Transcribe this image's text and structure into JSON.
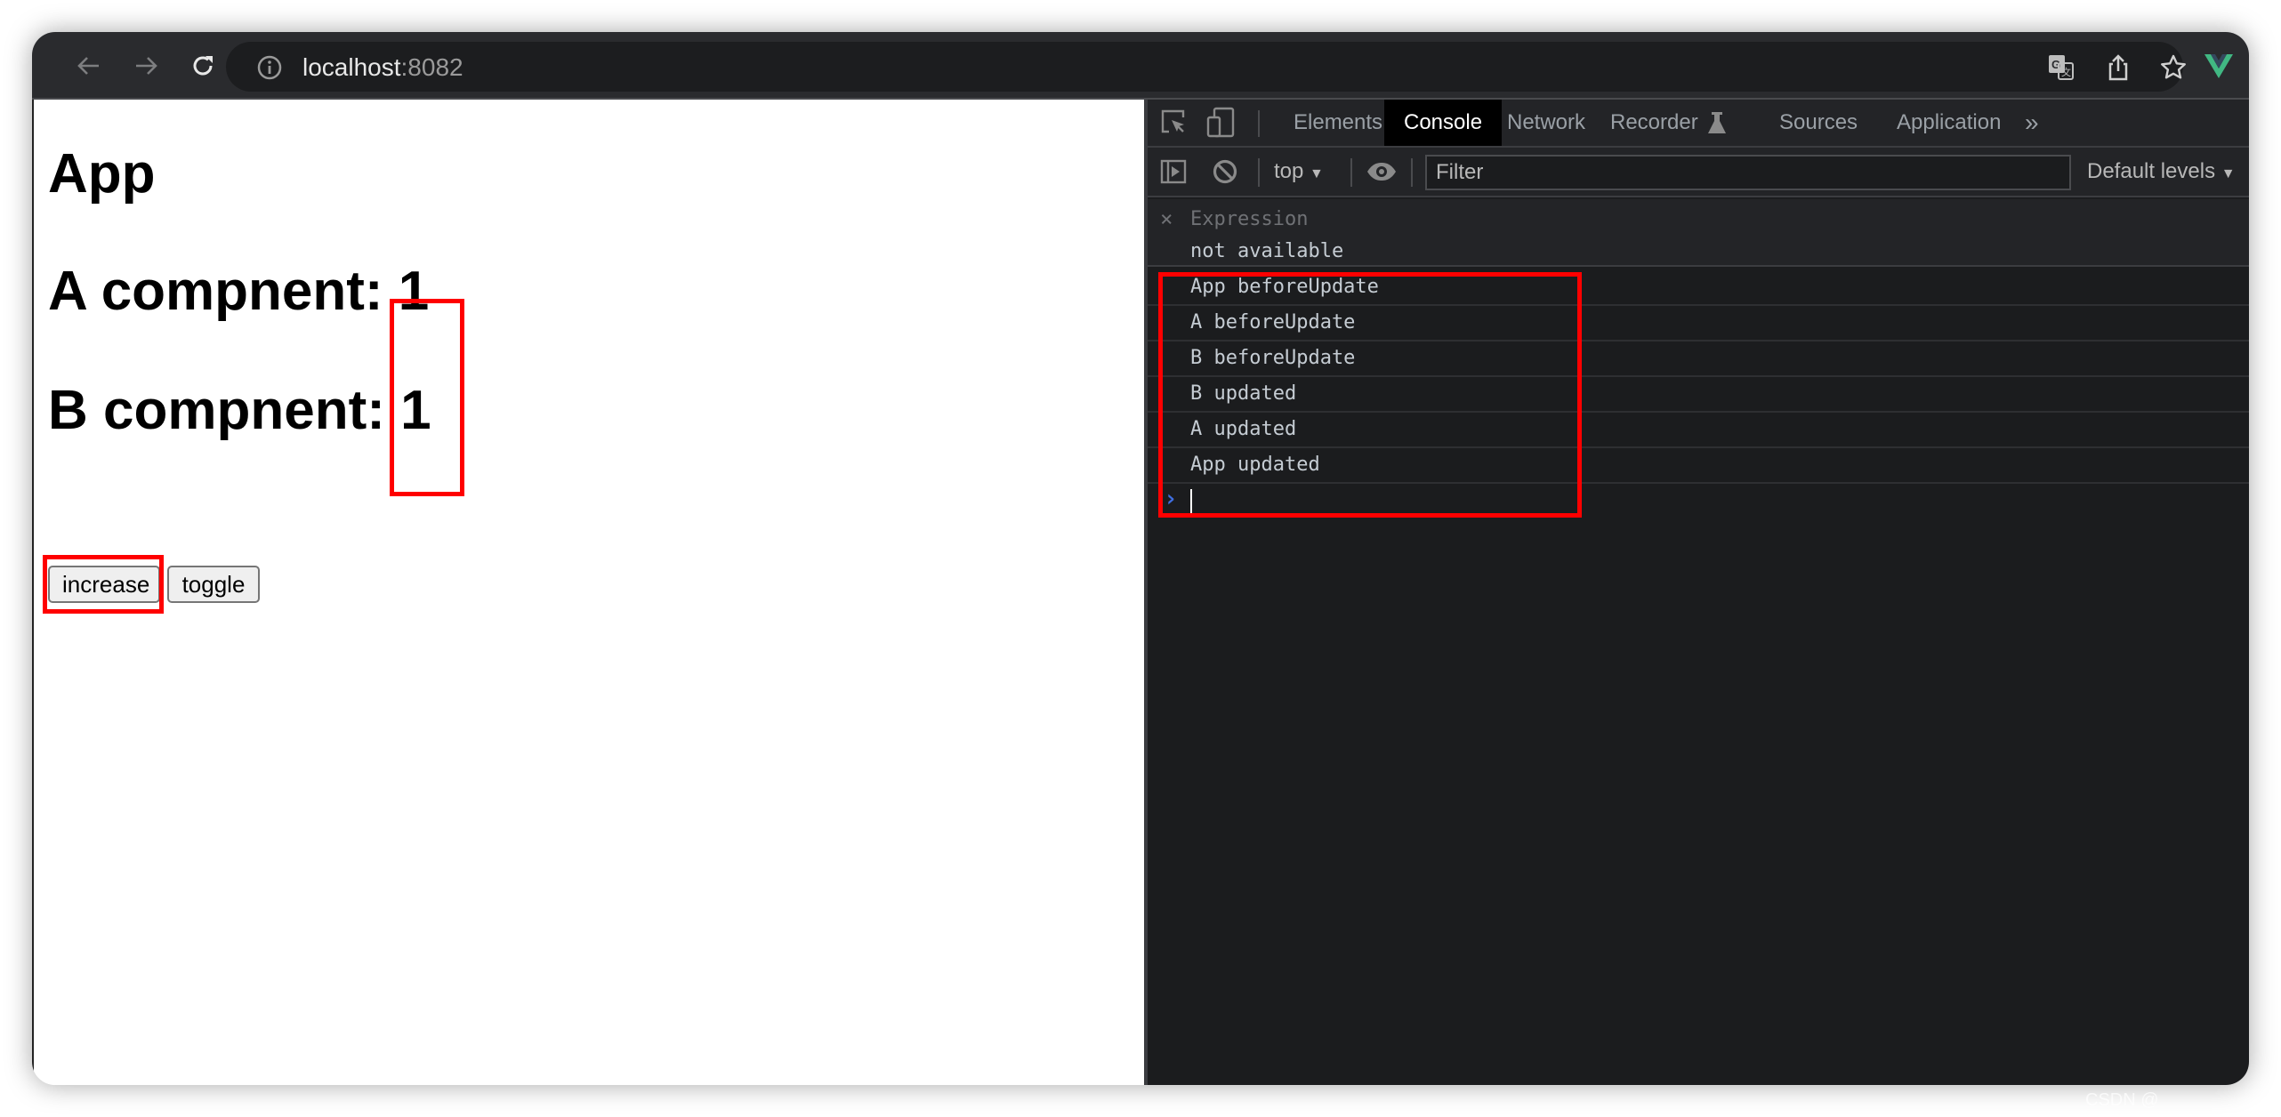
{
  "browser": {
    "url_host": "localhost",
    "url_port": ":8082",
    "icons": [
      "back-icon",
      "forward-icon",
      "reload-icon",
      "info-icon",
      "translate-icon",
      "share-icon",
      "bookmark-star-icon",
      "vue-devtools-icon"
    ],
    "accent_vue": "#41b883"
  },
  "page": {
    "title": "App",
    "a_label": "A compnent: ",
    "a_value": "1",
    "b_label": "B compnent: ",
    "b_value": "1",
    "buttons": {
      "increase": "increase",
      "toggle": "toggle"
    }
  },
  "devtools": {
    "tabs": [
      {
        "label": "Elements",
        "active": false
      },
      {
        "label": "Console",
        "active": true
      },
      {
        "label": "Network",
        "active": false
      },
      {
        "label": "Recorder",
        "active": false
      },
      {
        "label": "Sources",
        "active": false
      },
      {
        "label": "Application",
        "active": false
      }
    ],
    "more_tabs": "»",
    "context": "top",
    "filter_placeholder": "Filter",
    "levels": "Default levels",
    "expression": {
      "close": "×",
      "label": "Expression",
      "value": "not available"
    },
    "logs": [
      "App beforeUpdate",
      "A beforeUpdate",
      "B beforeUpdate",
      "B updated",
      "A updated",
      "App updated"
    ],
    "prompt": "›"
  },
  "highlight_color": "#ff0000",
  "watermark": "CSDN @"
}
